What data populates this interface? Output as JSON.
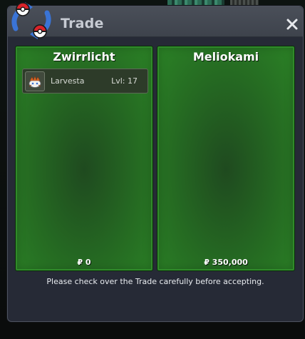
{
  "window": {
    "title": "Trade",
    "close_icon": "close-icon",
    "title_icon": "pokeball-swap-icon",
    "colors": {
      "window_bg": "#262a36",
      "titlebar": "#444952",
      "panel_green": "#2b8226",
      "panel_dark_green": "#1f4a1f"
    }
  },
  "left_panel": {
    "trainer_name": "Zwirrlicht",
    "items": [
      {
        "icon": "larvesta-sprite-icon",
        "name": "Larvesta",
        "level": "Lvl: 17"
      }
    ],
    "money": "₽ 0"
  },
  "right_panel": {
    "trainer_name": "Meliokami",
    "items": [],
    "money": "₽ 350,000"
  },
  "footer": {
    "message": "Please check over the Trade carefully before accepting."
  }
}
